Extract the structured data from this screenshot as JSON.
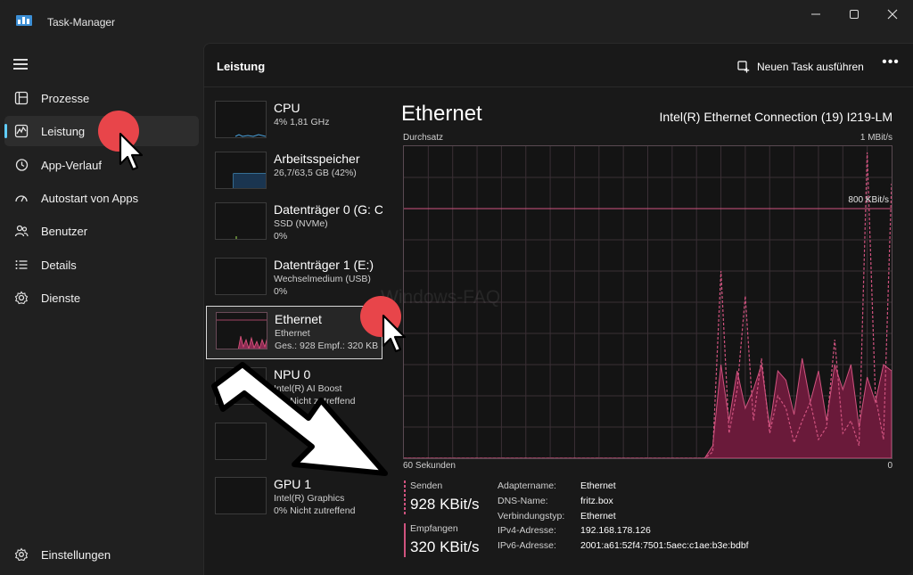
{
  "window": {
    "title": "Task-Manager",
    "minimize_icon": "minimize-icon",
    "maximize_icon": "maximize-icon",
    "close_icon": "close-icon"
  },
  "nav": {
    "items": [
      {
        "label": "Prozesse",
        "icon": "processes-icon"
      },
      {
        "label": "Leistung",
        "icon": "performance-icon",
        "active": true
      },
      {
        "label": "App-Verlauf",
        "icon": "history-icon"
      },
      {
        "label": "Autostart von Apps",
        "icon": "startup-icon"
      },
      {
        "label": "Benutzer",
        "icon": "users-icon"
      },
      {
        "label": "Details",
        "icon": "details-icon"
      },
      {
        "label": "Dienste",
        "icon": "services-icon"
      }
    ],
    "settings_label": "Einstellungen"
  },
  "header": {
    "title": "Leistung",
    "run_task_label": "Neuen Task ausführen",
    "more_label": "•••"
  },
  "resources": [
    {
      "name": "CPU",
      "sub1": "4%  1,81 GHz",
      "sub2": "",
      "color": "#4aa3df"
    },
    {
      "name": "Arbeitsspeicher",
      "sub1": "26,7/63,5 GB (42%)",
      "sub2": "",
      "color": "#4aa3df"
    },
    {
      "name": "Datenträger 0 (G: C",
      "sub1": "SSD (NVMe)",
      "sub2": "0%",
      "color": "#8bc34a"
    },
    {
      "name": "Datenträger 1 (E:)",
      "sub1": "Wechselmedium (USB)",
      "sub2": "0%",
      "color": "#8bc34a"
    },
    {
      "name": "Ethernet",
      "sub1": "Ethernet",
      "sub2": "Ges.: 928  Empf.: 320 KB",
      "color": "#e0557f",
      "selected": true
    },
    {
      "name": "NPU 0",
      "sub1": "Intel(R) AI Boost",
      "sub2": "0%  Nicht zutreffend",
      "color": "#4aa3df"
    },
    {
      "name": "",
      "sub1": "",
      "sub2": "",
      "color": "#4aa3df"
    },
    {
      "name": "GPU 1",
      "sub1": "Intel(R) Graphics",
      "sub2": "0%  Nicht zutreffend",
      "color": "#4aa3df"
    }
  ],
  "detail": {
    "title": "Ethernet",
    "adapter": "Intel(R) Ethernet Connection (19) I219-LM",
    "graph": {
      "ylabel": "Durchsatz",
      "ymax_label": "1 MBit/s",
      "ref_label": "800 KBit/s",
      "xleft_label": "60 Sekunden",
      "xright_label": "0",
      "grid_color": "#3a2f35",
      "line_color": "#d0537f",
      "fill_color": "#6a1a3a",
      "send_series": [
        0,
        0,
        0,
        0,
        0,
        0,
        0,
        0,
        0,
        0,
        0,
        0,
        0,
        0,
        0,
        0,
        0,
        0,
        0,
        0,
        0,
        0,
        0,
        0,
        0,
        0,
        0,
        0,
        0,
        0,
        0,
        0,
        0,
        0,
        0,
        0,
        0,
        0,
        0.02,
        0.6,
        0.08,
        0.22,
        0.52,
        0.12,
        0.32,
        0.08,
        0.2,
        0.16,
        0.05,
        0.12,
        0.18,
        0.06,
        0.1,
        0.38,
        0.08,
        0.12,
        0.04,
        0.98,
        0.2,
        0.06,
        0.88
      ],
      "receive_series": [
        0,
        0,
        0,
        0,
        0,
        0,
        0,
        0,
        0,
        0,
        0,
        0,
        0,
        0,
        0,
        0,
        0,
        0,
        0,
        0,
        0,
        0,
        0,
        0,
        0,
        0,
        0,
        0,
        0,
        0,
        0,
        0,
        0,
        0,
        0,
        0,
        0,
        0,
        0.04,
        0.3,
        0.12,
        0.28,
        0.16,
        0.22,
        0.3,
        0.1,
        0.28,
        0.25,
        0.14,
        0.32,
        0.18,
        0.28,
        0.12,
        0.3,
        0.22,
        0.3,
        0.1,
        0.26,
        0.18,
        0.3,
        0.28
      ]
    },
    "send": {
      "label": "Senden",
      "value": "928 KBit/s",
      "color": "#d0537f"
    },
    "receive": {
      "label": "Empfangen",
      "value": "320 KBit/s",
      "color": "#d0537f"
    },
    "properties": [
      {
        "key": "Adaptername:",
        "value": "Ethernet"
      },
      {
        "key": "DNS-Name:",
        "value": "fritz.box"
      },
      {
        "key": "Verbindungstyp:",
        "value": "Ethernet"
      },
      {
        "key": "IPv4-Adresse:",
        "value": "192.168.178.126"
      },
      {
        "key": "IPv6-Adresse:",
        "value": "2001:a61:52f4:7501:5aec:c1ae:b3e:bdbf"
      }
    ]
  },
  "watermark": "Windows-FAQ"
}
